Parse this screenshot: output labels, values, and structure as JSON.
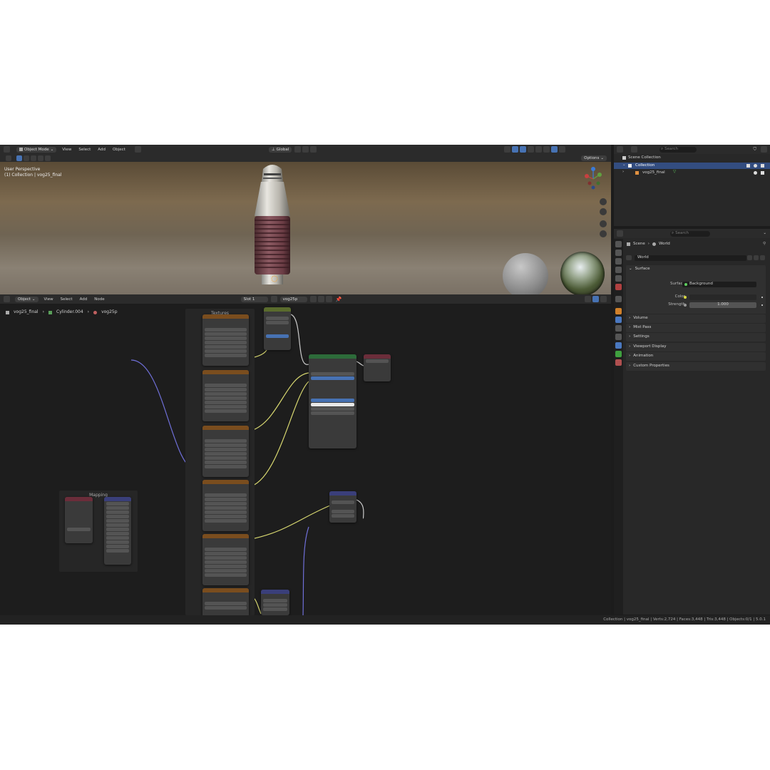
{
  "viewport_header": {
    "mode": "Object Mode",
    "menus": [
      "View",
      "Select",
      "Add",
      "Object"
    ],
    "transform_orientation": "Global",
    "options_label": "Options"
  },
  "viewport_overlay": {
    "perspective": "User Perspective",
    "collection_line": "(1) Collection | vog25_final"
  },
  "node_header": {
    "type": "Object",
    "menus": [
      "View",
      "Select",
      "Add",
      "Node"
    ],
    "slot": "Slot 1",
    "material": "vog25p"
  },
  "breadcrumb": [
    "vog25_final",
    "Cylinder.004",
    "vog25p"
  ],
  "frames": {
    "mapping": "Mapping",
    "textures": "Textures"
  },
  "outliner": {
    "search_placeholder": "Search",
    "scene_collection": "Scene Collection",
    "collection": "Collection",
    "object": "vog25_final"
  },
  "properties": {
    "search_placeholder": "Search",
    "breadcrumb": [
      "Scene",
      "World"
    ],
    "world_name": "World",
    "surface_panel": "Surface",
    "surface_label": "Surface",
    "surface_value": "Background",
    "color_label": "Color",
    "strength_label": "Strength",
    "strength_value": "1.000",
    "panels": [
      "Volume",
      "Mist Pass",
      "Settings",
      "Viewport Display",
      "Animation",
      "Custom Properties"
    ]
  },
  "statusbar": {
    "text": "Collection | vog25_final | Verts:2,724 | Faces:3,448 | Tris:3,448 | Objects:0/1 | 5.0.1"
  },
  "colors": {
    "accent": "#4772b3",
    "texture_header": "#7a4d1e",
    "shader_header": "#2d6b3a",
    "output_header": "#6b2d3a",
    "vector_header": "#3a3f7a",
    "link_yellow": "#d8d870",
    "link_purple": "#6f6fd8",
    "link_white": "#cccccc"
  }
}
